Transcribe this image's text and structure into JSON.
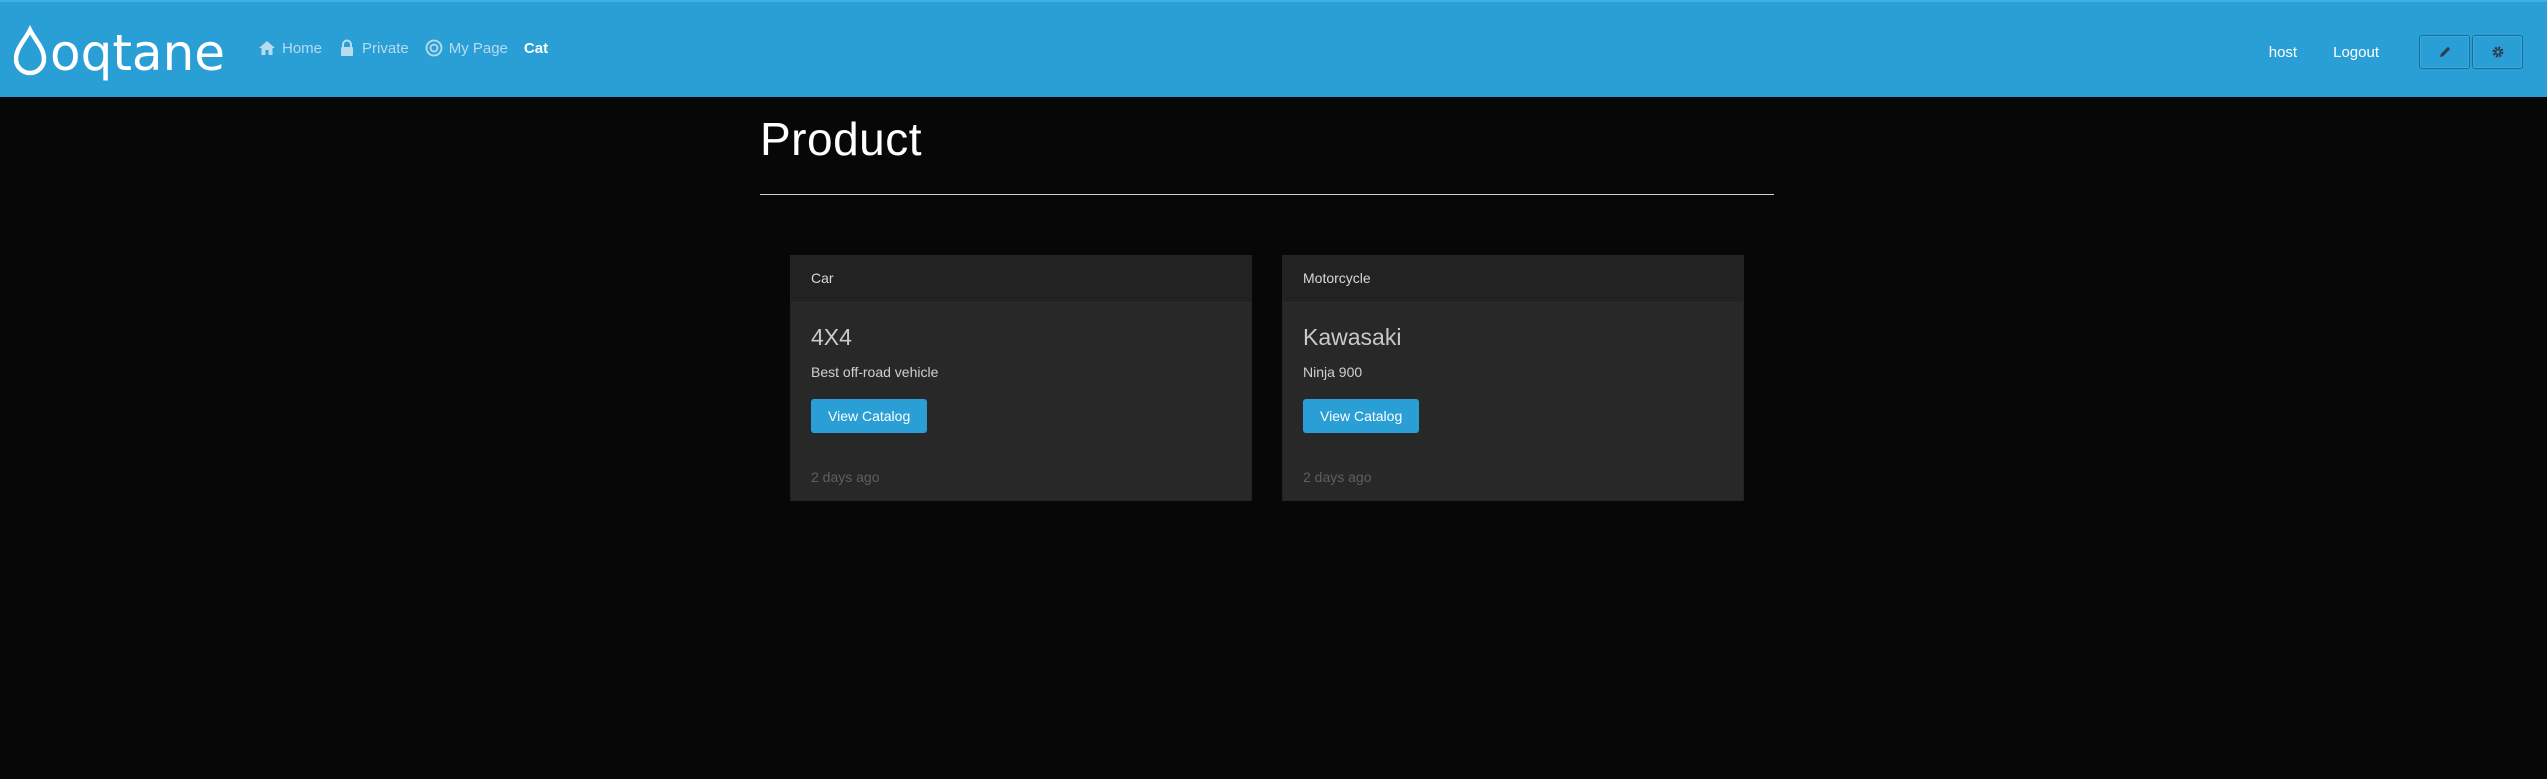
{
  "header": {
    "logo_text": "oqtane",
    "nav": [
      {
        "label": "Home",
        "icon": "home-icon"
      },
      {
        "label": "Private",
        "icon": "lock-icon"
      },
      {
        "label": "My Page",
        "icon": "target-icon"
      },
      {
        "label": "Cat",
        "icon": ""
      }
    ],
    "user_label": "host",
    "logout_label": "Logout",
    "edit_icon": "pencil-icon",
    "settings_icon": "gear-icon"
  },
  "main": {
    "title": "Product",
    "cards": [
      {
        "category": "Car",
        "title": "4X4",
        "description": "Best off-road vehicle",
        "button_label": "View Catalog",
        "time": "2 days ago"
      },
      {
        "category": "Motorcycle",
        "title": "Kawasaki",
        "description": "Ninja 900",
        "button_label": "View Catalog",
        "time": "2 days ago"
      }
    ]
  },
  "colors": {
    "navbar": "#2a9fd6",
    "background": "#070707",
    "card": "#282828",
    "button": "#2a9fd6"
  }
}
